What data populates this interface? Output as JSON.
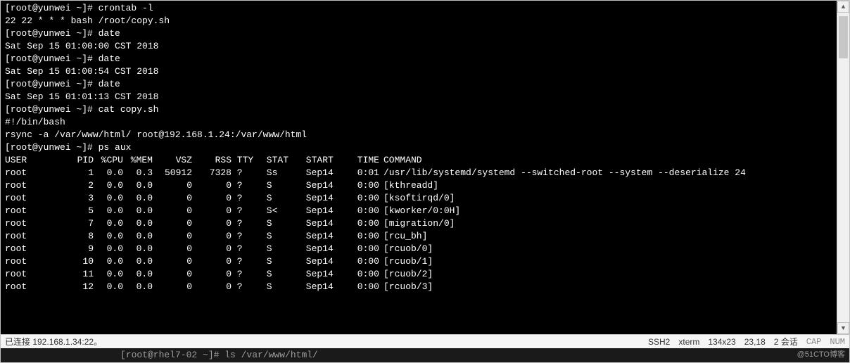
{
  "prompt": "[root@yunwei ~]#",
  "session": [
    {
      "type": "cmd",
      "text": "crontab -l"
    },
    {
      "type": "out",
      "text": "22 22 * * * bash /root/copy.sh"
    },
    {
      "type": "cmd",
      "text": "date"
    },
    {
      "type": "out",
      "text": "Sat Sep 15 01:00:00 CST 2018"
    },
    {
      "type": "cmd",
      "text": "date"
    },
    {
      "type": "out",
      "text": "Sat Sep 15 01:00:54 CST 2018"
    },
    {
      "type": "cmd",
      "text": "date"
    },
    {
      "type": "out",
      "text": "Sat Sep 15 01:01:13 CST 2018"
    },
    {
      "type": "cmd",
      "text": "cat copy.sh"
    },
    {
      "type": "out",
      "text": "#!/bin/bash"
    },
    {
      "type": "out",
      "text": "rsync -a /var/www/html/ root@192.168.1.24:/var/www/html"
    },
    {
      "type": "cmd",
      "text": "ps aux"
    }
  ],
  "ps_header": {
    "user": "USER",
    "pid": "PID",
    "cpu": "%CPU",
    "mem": "%MEM",
    "vsz": "VSZ",
    "rss": "RSS",
    "tty": "TTY",
    "stat": "STAT",
    "start": "START",
    "time": "TIME",
    "cmd": "COMMAND"
  },
  "ps_rows": [
    {
      "user": "root",
      "pid": "1",
      "cpu": "0.0",
      "mem": "0.3",
      "vsz": "50912",
      "rss": "7328",
      "tty": "?",
      "stat": "Ss",
      "start": "Sep14",
      "time": "0:01",
      "cmd": "/usr/lib/systemd/systemd --switched-root --system --deserialize 24"
    },
    {
      "user": "root",
      "pid": "2",
      "cpu": "0.0",
      "mem": "0.0",
      "vsz": "0",
      "rss": "0",
      "tty": "?",
      "stat": "S",
      "start": "Sep14",
      "time": "0:00",
      "cmd": "[kthreadd]"
    },
    {
      "user": "root",
      "pid": "3",
      "cpu": "0.0",
      "mem": "0.0",
      "vsz": "0",
      "rss": "0",
      "tty": "?",
      "stat": "S",
      "start": "Sep14",
      "time": "0:00",
      "cmd": "[ksoftirqd/0]"
    },
    {
      "user": "root",
      "pid": "5",
      "cpu": "0.0",
      "mem": "0.0",
      "vsz": "0",
      "rss": "0",
      "tty": "?",
      "stat": "S<",
      "start": "Sep14",
      "time": "0:00",
      "cmd": "[kworker/0:0H]"
    },
    {
      "user": "root",
      "pid": "7",
      "cpu": "0.0",
      "mem": "0.0",
      "vsz": "0",
      "rss": "0",
      "tty": "?",
      "stat": "S",
      "start": "Sep14",
      "time": "0:00",
      "cmd": "[migration/0]"
    },
    {
      "user": "root",
      "pid": "8",
      "cpu": "0.0",
      "mem": "0.0",
      "vsz": "0",
      "rss": "0",
      "tty": "?",
      "stat": "S",
      "start": "Sep14",
      "time": "0:00",
      "cmd": "[rcu_bh]"
    },
    {
      "user": "root",
      "pid": "9",
      "cpu": "0.0",
      "mem": "0.0",
      "vsz": "0",
      "rss": "0",
      "tty": "?",
      "stat": "S",
      "start": "Sep14",
      "time": "0:00",
      "cmd": "[rcuob/0]"
    },
    {
      "user": "root",
      "pid": "10",
      "cpu": "0.0",
      "mem": "0.0",
      "vsz": "0",
      "rss": "0",
      "tty": "?",
      "stat": "S",
      "start": "Sep14",
      "time": "0:00",
      "cmd": "[rcuob/1]"
    },
    {
      "user": "root",
      "pid": "11",
      "cpu": "0.0",
      "mem": "0.0",
      "vsz": "0",
      "rss": "0",
      "tty": "?",
      "stat": "S",
      "start": "Sep14",
      "time": "0:00",
      "cmd": "[rcuob/2]"
    },
    {
      "user": "root",
      "pid": "12",
      "cpu": "0.0",
      "mem": "0.0",
      "vsz": "0",
      "rss": "0",
      "tty": "?",
      "stat": "S",
      "start": "Sep14",
      "time": "0:00",
      "cmd": "[rcuob/3]"
    }
  ],
  "statusbar": {
    "connected": "已连接 192.168.1.34:22。",
    "proto": "SSH2",
    "term": "xterm",
    "size": "134x23",
    "cursor": "23,18",
    "sessions": "2 会话",
    "cap": "CAP",
    "num": "NUM"
  },
  "shadow": {
    "text": "[root@rhel7-02 ~]# ls /var/www/html/"
  },
  "watermark": "@51CTO博客"
}
